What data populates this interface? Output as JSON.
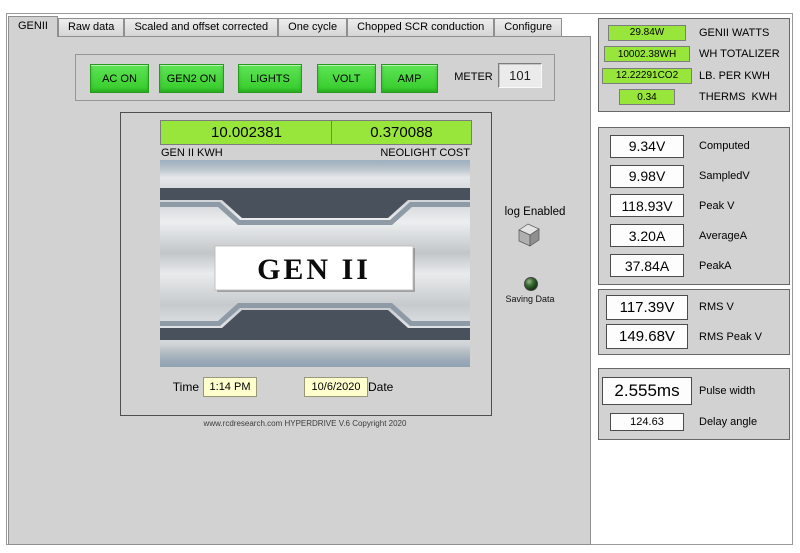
{
  "tabs": [
    {
      "label": "GENII",
      "active": true
    },
    {
      "label": "Raw data"
    },
    {
      "label": "Scaled and offset corrected"
    },
    {
      "label": "One cycle"
    },
    {
      "label": "Chopped SCR conduction"
    },
    {
      "label": "Configure"
    }
  ],
  "toolbar": {
    "buttons": [
      "AC ON",
      "GEN2 ON",
      "LIGHTS",
      "VOLT",
      "AMP"
    ],
    "meter_label": "METER",
    "meter_value": "101"
  },
  "displays": {
    "kwh": {
      "value": "10.002381",
      "label": "GEN II KWH"
    },
    "cost": {
      "value": "0.370088",
      "label": "NEOLIGHT COST"
    }
  },
  "plate": {
    "title": "GEN II"
  },
  "datetime": {
    "time_label": "Time",
    "time_value": "1:14 PM",
    "date_value": "10/6/2020",
    "date_label": "Date"
  },
  "footer": {
    "text": "www.rcdresearch.com HYPERDRIVE V.6 Copyright 2020"
  },
  "log": {
    "label": "log Enabled"
  },
  "saving": {
    "label": "Saving Data"
  },
  "sidebar": {
    "panels": [
      {
        "rows": [
          {
            "value": "29.84W",
            "label": "GENII WATTS"
          },
          {
            "value": "10002.38WH",
            "label": "WH TOTALIZER"
          },
          {
            "value": "12.22291CO2",
            "label": "LB. PER KWH"
          },
          {
            "value": "0.34",
            "label": "THERMS  KWH"
          }
        ]
      },
      {
        "rows": [
          {
            "value": "9.34V",
            "label": "Computed"
          },
          {
            "value": "9.98V",
            "label": "SampledV"
          },
          {
            "value": "118.93V",
            "label": "Peak V"
          },
          {
            "value": "3.20A",
            "label": "AverageA"
          },
          {
            "value": "37.84A",
            "label": "PeakA"
          }
        ]
      },
      {
        "rows": [
          {
            "value": "117.39V",
            "label": "RMS V"
          },
          {
            "value": "149.68V",
            "label": "RMS Peak V"
          }
        ]
      },
      {
        "rows": [
          {
            "value": "2.555ms",
            "label": "Pulse width"
          },
          {
            "value": "124.63",
            "label": "Delay angle"
          }
        ]
      }
    ]
  },
  "colors": {
    "button_green": "#3ccf31",
    "display_green": "#98e63b",
    "field_yellow": "#ffffce",
    "panel_gray": "#d2d2d2"
  }
}
